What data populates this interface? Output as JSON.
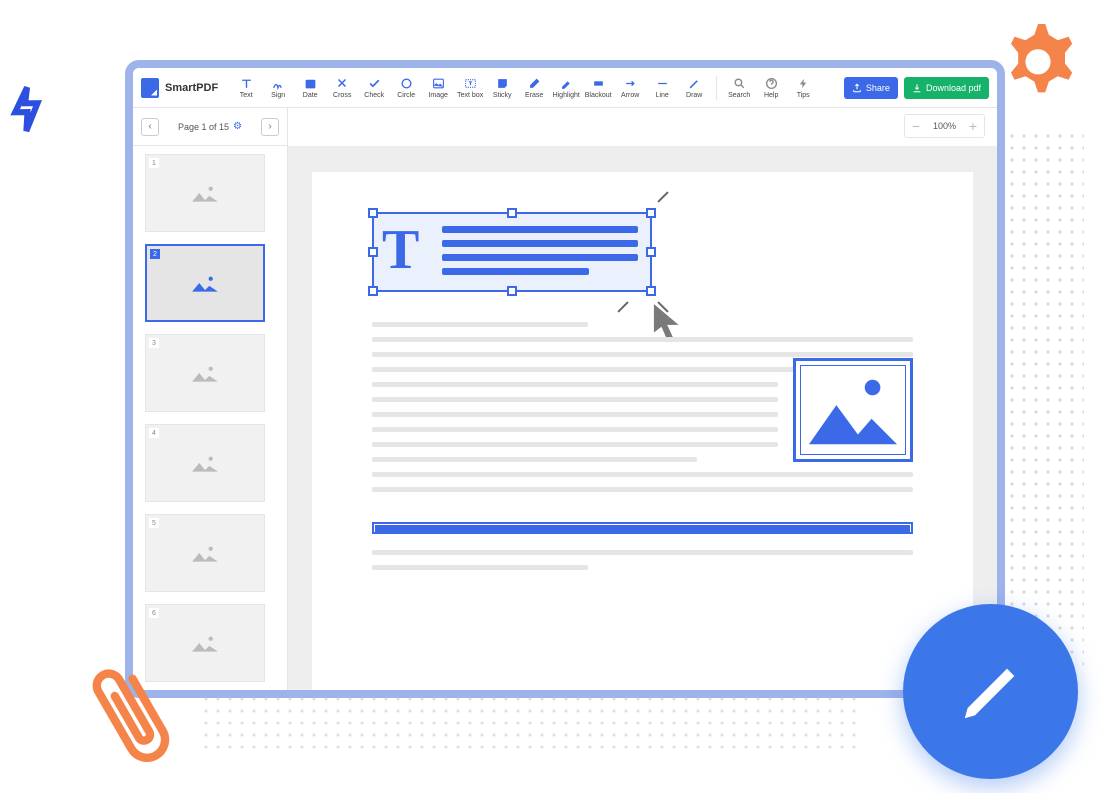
{
  "brand": "SmartPDF",
  "tools": [
    {
      "id": "text",
      "label": "Text"
    },
    {
      "id": "sign",
      "label": "Sign"
    },
    {
      "id": "date",
      "label": "Date"
    },
    {
      "id": "cross",
      "label": "Cross"
    },
    {
      "id": "check",
      "label": "Check"
    },
    {
      "id": "circle",
      "label": "Circle"
    },
    {
      "id": "image",
      "label": "Image"
    },
    {
      "id": "textbox",
      "label": "Text box"
    },
    {
      "id": "sticky",
      "label": "Sticky"
    },
    {
      "id": "erase",
      "label": "Erase"
    },
    {
      "id": "highlight",
      "label": "Highlight"
    },
    {
      "id": "blackout",
      "label": "Blackout"
    },
    {
      "id": "arrow",
      "label": "Arrow"
    },
    {
      "id": "line",
      "label": "Line"
    },
    {
      "id": "draw",
      "label": "Draw"
    }
  ],
  "help_tools": [
    {
      "id": "search",
      "label": "Search"
    },
    {
      "id": "help",
      "label": "Help"
    },
    {
      "id": "tips",
      "label": "Tips"
    }
  ],
  "buttons": {
    "share": "Share",
    "download": "Download pdf"
  },
  "pager": {
    "label": "Page 1 of 15",
    "current": 1,
    "total": 15
  },
  "zoom": {
    "value": "100%"
  },
  "thumbs": [
    1,
    2,
    3,
    4,
    5,
    6
  ],
  "active_thumb": 2
}
